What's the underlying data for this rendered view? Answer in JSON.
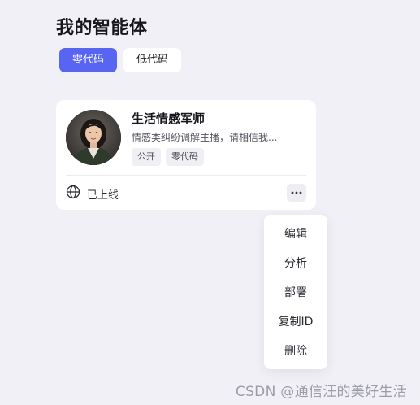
{
  "header": {
    "title": "我的智能体"
  },
  "tabs": [
    {
      "label": "零代码",
      "active": true
    },
    {
      "label": "低代码",
      "active": false
    }
  ],
  "agent_card": {
    "title": "生活情感军师",
    "description": "情感类纠纷调解主播，请相信我...",
    "tags": [
      "公开",
      "零代码"
    ],
    "status_icon": "globe-icon",
    "status": "已上线",
    "more_icon": "more-horizontal-icon"
  },
  "context_menu": {
    "items": [
      "编辑",
      "分析",
      "部署",
      "复制ID",
      "删除"
    ]
  },
  "watermark": "CSDN @通信汪的美好生活",
  "colors": {
    "accent": "#5865f2",
    "background": "#f0f0f6"
  }
}
